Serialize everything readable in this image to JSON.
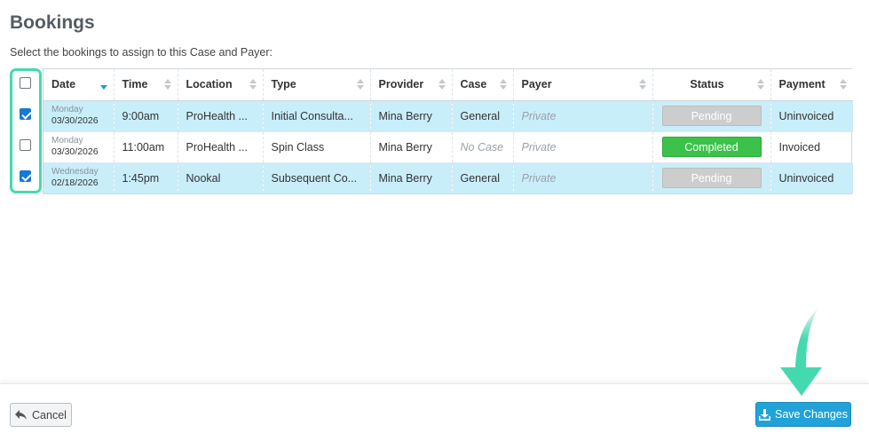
{
  "page": {
    "title": "Bookings",
    "subtitle": "Select the bookings to assign to this Case and Payer:"
  },
  "table": {
    "columns": [
      "Date",
      "Time",
      "Location",
      "Type",
      "Provider",
      "Case",
      "Payer",
      "Status",
      "Payment"
    ],
    "rows": [
      {
        "checked": true,
        "day": "Monday",
        "date": "03/30/2026",
        "time": "9:00am",
        "location": "ProHealth ...",
        "type": "Initial Consulta...",
        "provider": "Mina Berry",
        "case": "General",
        "payer": "Private",
        "status": "Pending",
        "payment": "Uninvoiced"
      },
      {
        "checked": false,
        "day": "Monday",
        "date": "03/30/2026",
        "time": "11:00am",
        "location": "ProHealth ...",
        "type": "Spin Class",
        "provider": "Mina Berry",
        "case": "No Case",
        "payer": "Private",
        "status": "Completed",
        "payment": "Invoiced"
      },
      {
        "checked": true,
        "day": "Wednesday",
        "date": "02/18/2026",
        "time": "1:45pm",
        "location": "Nookal",
        "type": "Subsequent Co...",
        "provider": "Mina Berry",
        "case": "General",
        "payer": "Private",
        "status": "Pending",
        "payment": "Uninvoiced"
      }
    ]
  },
  "footer": {
    "cancel_label": "Cancel",
    "save_label": "Save Changes"
  },
  "colors": {
    "highlight": "#45d9b0",
    "selected_row": "#c8eefa",
    "primary": "#21a3d9",
    "completed": "#3cc14a",
    "pending": "#cdcdcd"
  },
  "icons": {
    "cancel": "reply-arrow-icon",
    "save": "download-icon",
    "sort": "sort-icon"
  }
}
